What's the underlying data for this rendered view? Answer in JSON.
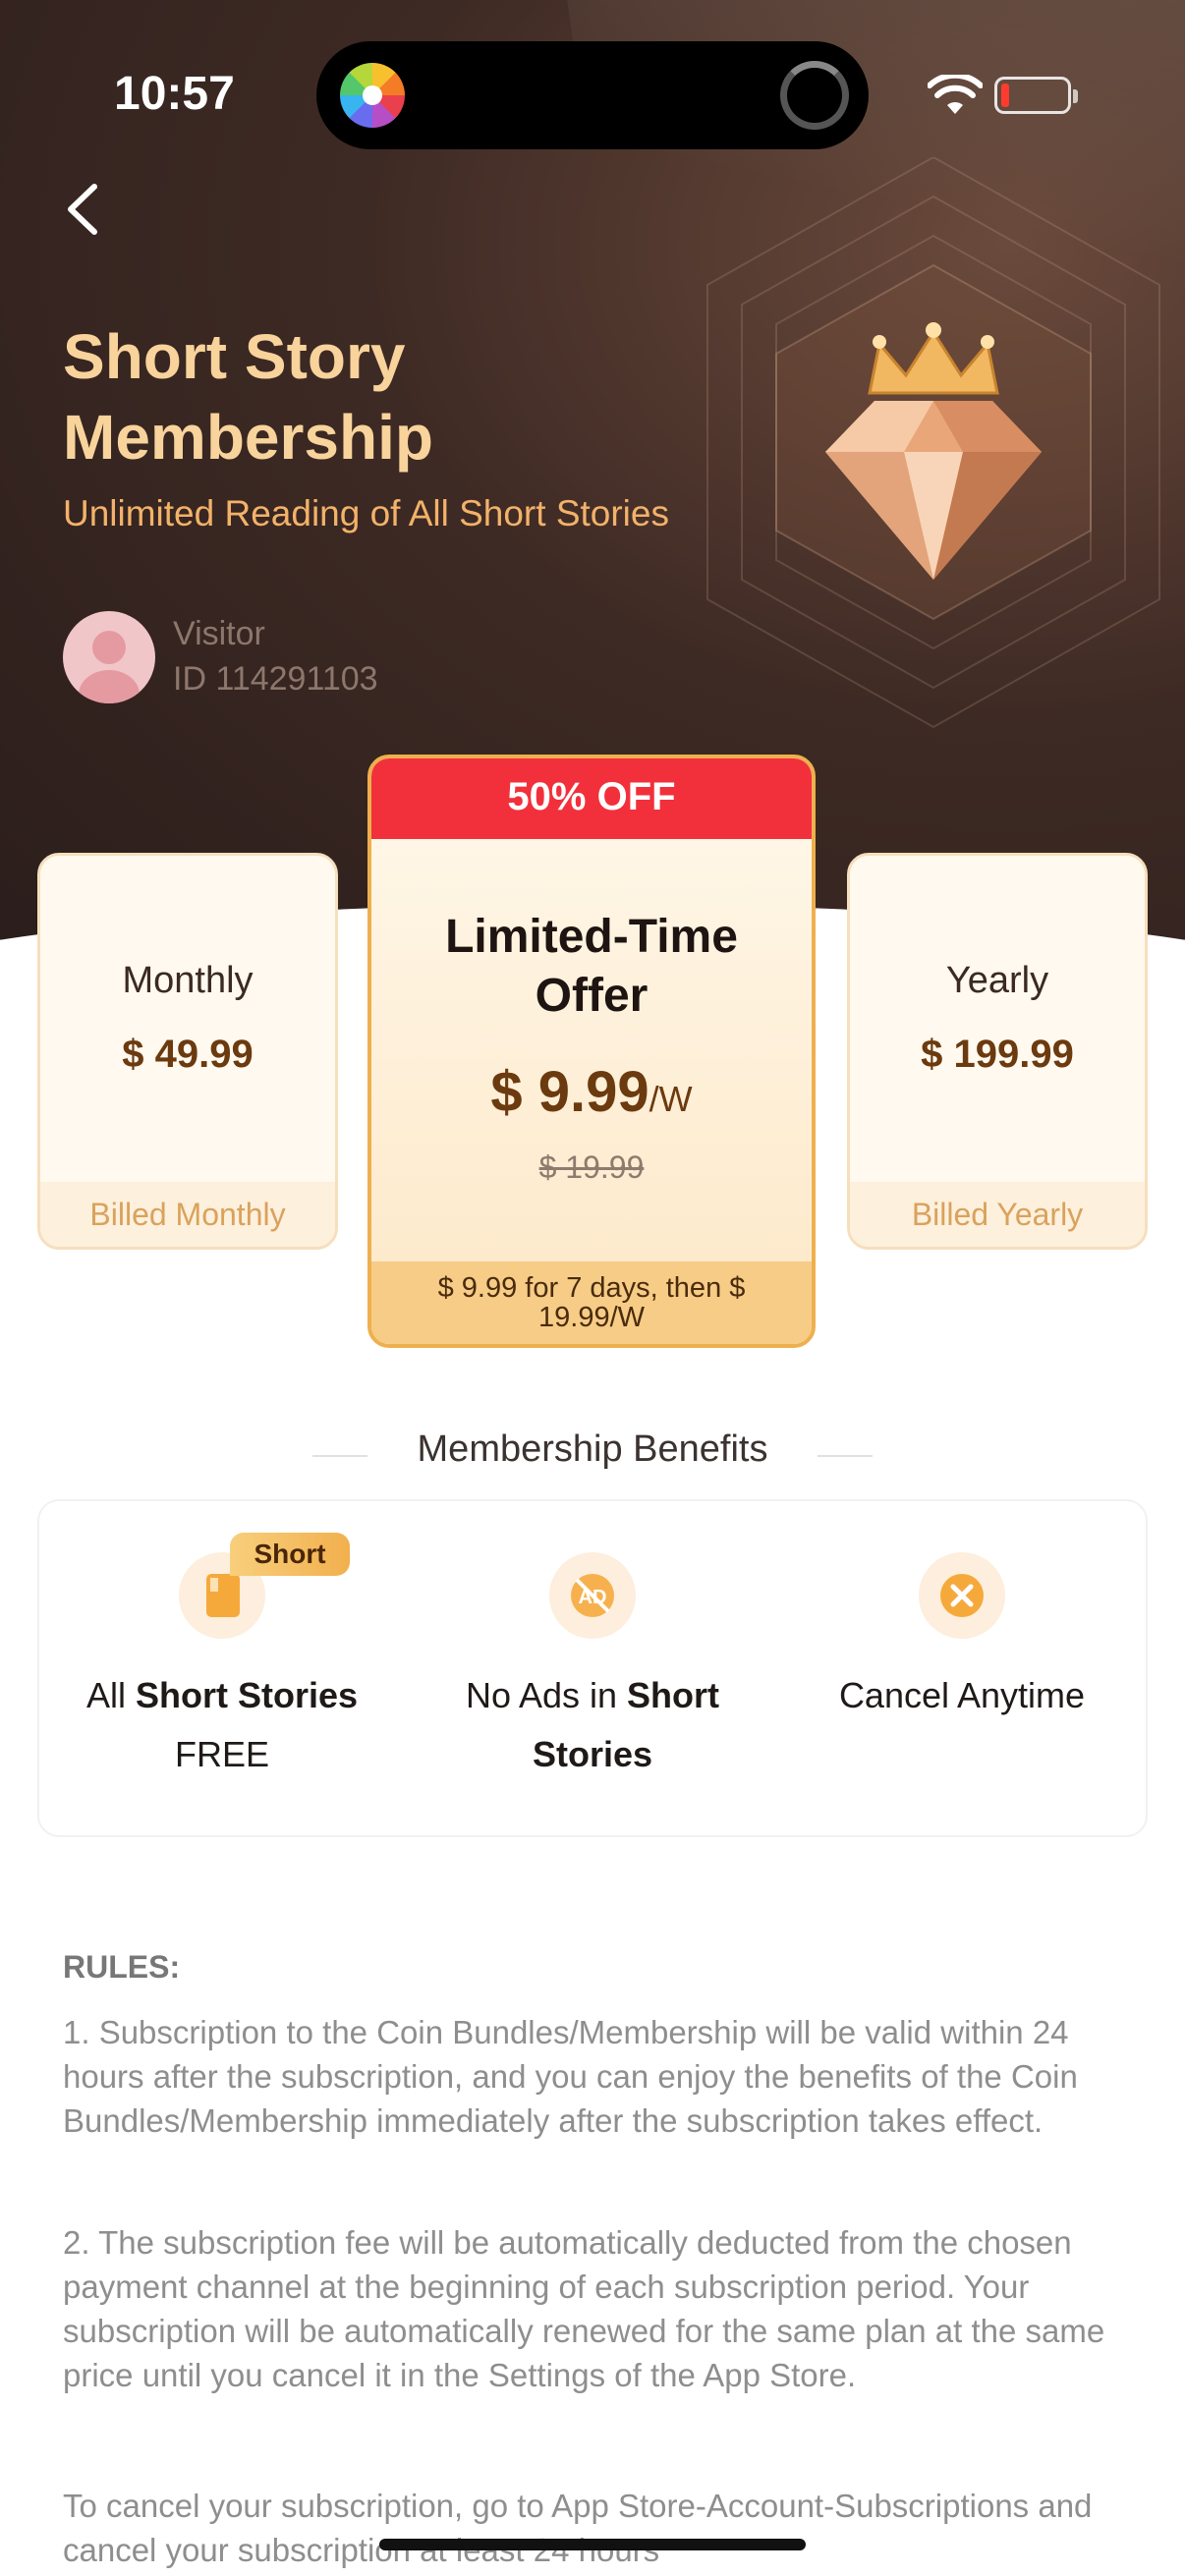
{
  "status_bar": {
    "time": "10:57"
  },
  "header": {
    "title": "Short Story Membership",
    "subtitle": "Unlimited Reading of All Short Stories"
  },
  "user": {
    "name": "Visitor",
    "id": "ID 114291103"
  },
  "plans": {
    "monthly": {
      "name": "Monthly",
      "price": "$ 49.99",
      "billing": "Billed Monthly"
    },
    "featured": {
      "badge": "50% OFF",
      "name": "Limited-Time Offer",
      "price": "$ 9.99",
      "unit": "/W",
      "original_price": "$ 19.99",
      "terms": "$ 9.99 for 7 days, then $ 19.99/W"
    },
    "yearly": {
      "name": "Yearly",
      "price": "$ 199.99",
      "billing": "Billed Yearly"
    }
  },
  "benefits": {
    "heading": "Membership Benefits",
    "tag": "Short",
    "items": [
      {
        "prefix": "All ",
        "bold": "Short Stories",
        "suffix": "FREE"
      },
      {
        "prefix": "No Ads in ",
        "bold": "Short Stories",
        "suffix": ""
      },
      {
        "prefix": "Cancel Anytime",
        "bold": "",
        "suffix": ""
      }
    ]
  },
  "rules": {
    "title": "RULES:",
    "items": [
      "1. Subscription to the Coin Bundles/Membership will be valid within 24 hours after the subscription, and you can enjoy the benefits of the Coin Bundles/Membership immediately after the subscription takes effect.",
      "2. The subscription fee will be automatically deducted from the chosen payment channel at the beginning of each subscription period. Your subscription will be automatically renewed for the same plan at the same price until you cancel it in the Settings of the App Store.",
      "To cancel your subscription, go to App Store-Account-Subscriptions and cancel your subscription at least 24 hours"
    ]
  },
  "colors": {
    "accent_gold": "#f8d39b",
    "badge_red": "#f2303b",
    "price_brown": "#6b3a0f"
  },
  "icons": [
    "back-icon",
    "wifi-icon",
    "battery-icon",
    "crown-diamond-icon",
    "book-icon",
    "no-ads-icon",
    "cancel-icon"
  ]
}
